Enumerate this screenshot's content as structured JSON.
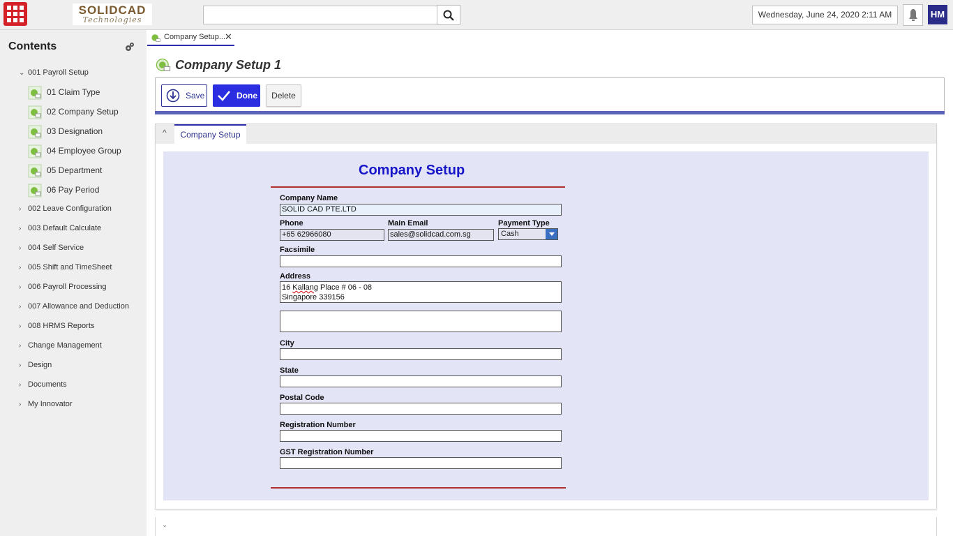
{
  "header": {
    "logo_line1": "SOLIDCAD",
    "logo_line2": "Technologies",
    "search_placeholder": "",
    "datetime": "Wednesday, June 24, 2020 2:11 AM",
    "avatar_initials": "HM"
  },
  "sidebar": {
    "title": "Contents",
    "groups": [
      {
        "label": "001 Payroll Setup",
        "expanded": true
      },
      {
        "label": "002 Leave Configuration"
      },
      {
        "label": "003 Default Calculate"
      },
      {
        "label": "004 Self Service"
      },
      {
        "label": "005 Shift and TimeSheet"
      },
      {
        "label": "006 Payroll Processing"
      },
      {
        "label": "007 Allowance and Deduction"
      },
      {
        "label": "008 HRMS Reports"
      },
      {
        "label": "Change Management"
      },
      {
        "label": "Design"
      },
      {
        "label": "Documents"
      },
      {
        "label": "My Innovator"
      }
    ],
    "items": [
      {
        "label": "01 Claim Type"
      },
      {
        "label": "02 Company Setup"
      },
      {
        "label": "03 Designation"
      },
      {
        "label": "04 Employee Group"
      },
      {
        "label": "05 Department"
      },
      {
        "label": "06 Pay Period"
      }
    ]
  },
  "tab": {
    "label": "Company Setup...",
    "close": "✕"
  },
  "page": {
    "title": "Company Setup 1"
  },
  "toolbar": {
    "save": "Save",
    "done": "Done",
    "delete": "Delete"
  },
  "section": {
    "tab_label": "Company Setup",
    "caret": "^"
  },
  "form": {
    "title": "Company Setup",
    "company_name_label": "Company Name",
    "company_name": "SOLID CAD PTE.LTD",
    "phone_label": "Phone",
    "phone": "+65 62966080",
    "email_label": "Main Email",
    "email": "sales@solidcad.com.sg",
    "payment_label": "Payment Type",
    "payment": "Cash",
    "fax_label": "Facsimile",
    "fax": "",
    "address_label": "Address",
    "address_line1_pre": "16 ",
    "address_line1_word": "Kallang",
    "address_line1_post": " Place # 06 - 08",
    "address_line2": "Singapore 339156",
    "address2": "",
    "city_label": "City",
    "city": "",
    "state_label": "State",
    "state": "",
    "postal_label": "Postal Code",
    "postal": "",
    "reg_label": "Registration Number",
    "reg": "",
    "gst_label": "GST Registration Number",
    "gst": ""
  },
  "colors": {
    "accent": "#2b2ea8",
    "brand_red": "#d42027",
    "form_bg": "#e4e4f7",
    "rule": "#b03030"
  }
}
